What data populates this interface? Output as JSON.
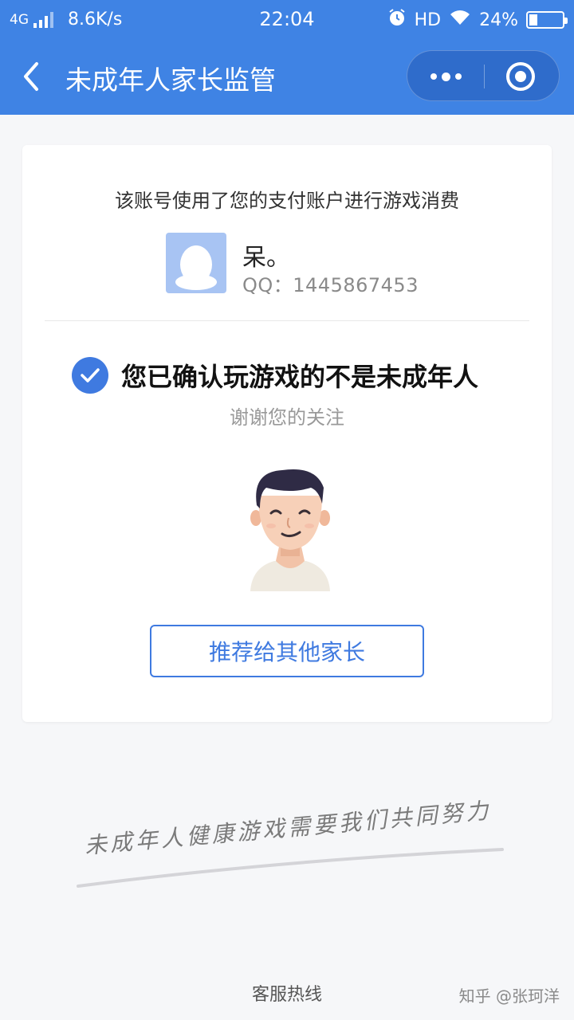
{
  "status_bar": {
    "network": "4G",
    "speed": "8.6K/s",
    "time": "22:04",
    "hd": "HD",
    "battery": "24%",
    "battery_level": 0.24
  },
  "navbar": {
    "title": "未成年人家长监管",
    "back_icon": "chevron-left-icon",
    "more_icon": "more-dots-icon",
    "close_icon": "target-icon"
  },
  "card": {
    "description": "该账号使用了您的支付账户进行游戏消费",
    "user": {
      "name": "呆。",
      "qq": "QQ：1445867453",
      "avatar_icon": "penguin-avatar-icon"
    },
    "confirm_text": "您已确认玩游戏的不是未成年人",
    "thanks": "谢谢您的关注",
    "recommend_button": "推荐给其他家长"
  },
  "slogan": "未成年人健康游戏需要我们共同努力",
  "hotline": "客服热线",
  "watermark": "知乎 @张珂洋",
  "colors": {
    "primary": "#3f83e4",
    "button_blue": "#3f7ae0",
    "avatar_bg": "#a8c4f3",
    "page_bg": "#f6f7f9"
  }
}
